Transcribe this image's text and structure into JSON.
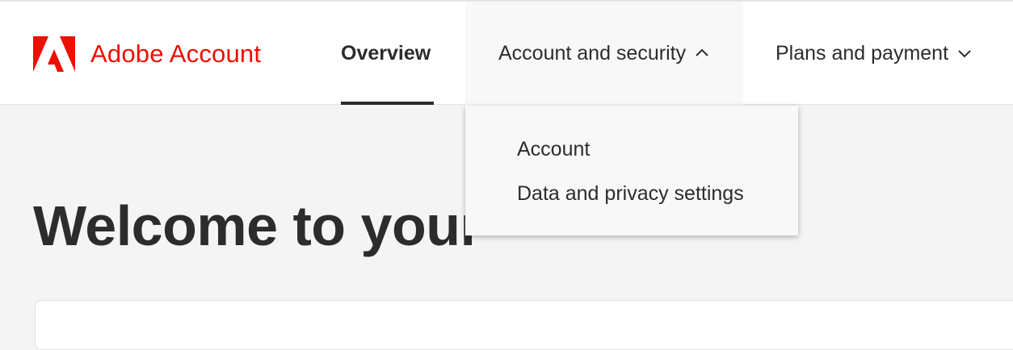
{
  "header": {
    "brand_name": "Adobe Account",
    "brand_color": "#eb1000",
    "logo_icon": "adobe-logo-icon",
    "nav": {
      "overview": "Overview",
      "account_security": "Account and security",
      "plans_payment": "Plans and payment"
    }
  },
  "dropdown": {
    "items": [
      "Account",
      "Data and privacy settings"
    ]
  },
  "main": {
    "title": "Welcome to your"
  }
}
